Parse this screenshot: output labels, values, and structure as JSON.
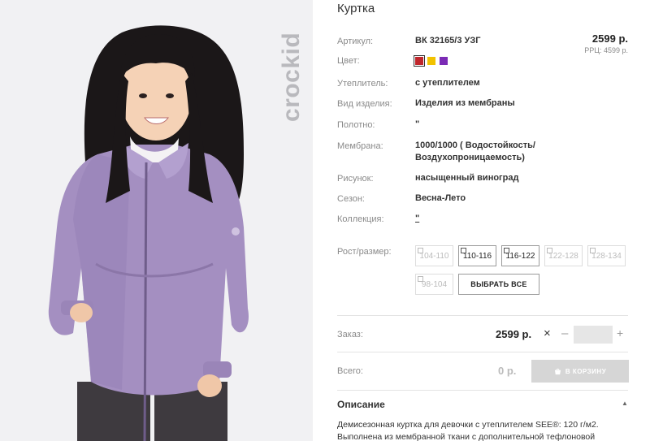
{
  "product": {
    "title": "Куртка",
    "price": "2599 р.",
    "rrc": "РРЦ: 4599 р."
  },
  "brand": {
    "logo_text": "crockid"
  },
  "colors": [
    "#c0262c",
    "#f2c200",
    "#7b2bb5"
  ],
  "specs": [
    {
      "label": "Артикул:",
      "value": "ВК 32165/3 УЗГ"
    },
    {
      "label": "Цвет:",
      "value": ""
    },
    {
      "label": "Утеплитель:",
      "value": "с утеплителем"
    },
    {
      "label": "Вид изделия:",
      "value": "Изделия из мембраны"
    },
    {
      "label": "Полотно:",
      "value": "\""
    },
    {
      "label": "Мембрана:",
      "value": "1000/1000 ( Водостойкость/",
      "value2": "Воздухопроницаемость)"
    },
    {
      "label": "Рисунок:",
      "value": "насыщенный виноград"
    },
    {
      "label": "Сезон:",
      "value": "Весна-Лето"
    },
    {
      "label": "Коллекция:",
      "value": "\""
    }
  ],
  "sizes": {
    "label": "Рост/размер:",
    "options": [
      "104-110",
      "110-116",
      "116-122",
      "122-128",
      "128-134",
      "98-104"
    ],
    "select_all": "ВЫБРАТЬ ВСЕ"
  },
  "order": {
    "label": "Заказ:",
    "price": "2599 р.",
    "times": "×",
    "minus": "–",
    "plus": "+",
    "quantity": ""
  },
  "total": {
    "label": "Всего:",
    "value": "0 р.",
    "cart_button": "В КОРЗИНУ"
  },
  "description": {
    "title": "Описание",
    "text": "Демисезонная куртка для девочки с утеплителем SEE®: 120 г/м2. Выполнена из мембранной ткани с дополнительной тефлоновой"
  }
}
